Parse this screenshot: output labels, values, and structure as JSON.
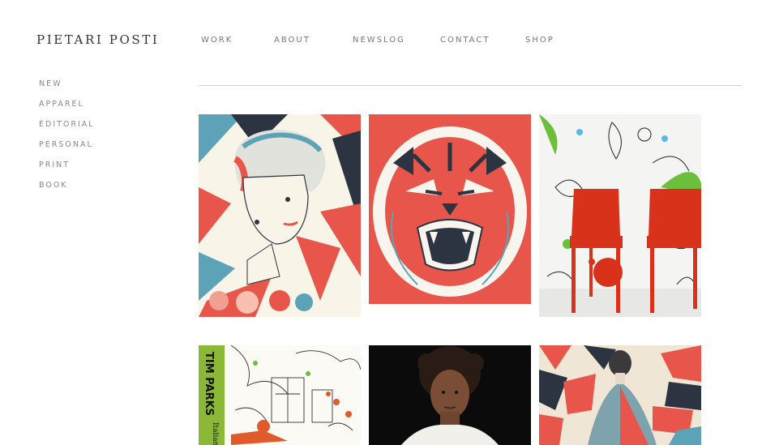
{
  "site": {
    "title": "PIETARI POSTI"
  },
  "topnav": {
    "items": [
      {
        "key": "work",
        "label": "WORK"
      },
      {
        "key": "about",
        "label": "ABOUT"
      },
      {
        "key": "newslog",
        "label": "NEWSLOG"
      },
      {
        "key": "contact",
        "label": "CONTACT"
      },
      {
        "key": "shop",
        "label": "SHOP"
      }
    ]
  },
  "sidenav": {
    "items": [
      {
        "key": "new",
        "label": "NEW"
      },
      {
        "key": "apparel",
        "label": "APPAREL"
      },
      {
        "key": "editorial",
        "label": "EDITORIAL"
      },
      {
        "key": "personal",
        "label": "PERSONAL"
      },
      {
        "key": "print",
        "label": "PRINT"
      },
      {
        "key": "book",
        "label": "BOOK"
      }
    ]
  },
  "gallery": {
    "book_cover": {
      "author": "TIM PARKS",
      "subtitle": "Italian"
    }
  },
  "colors": {
    "coral": "#e8554a",
    "teal": "#5ca3b8",
    "navy": "#2b3440",
    "cream": "#f8f4e8",
    "chair_red": "#d8321a",
    "leaf_green": "#6cbf3a",
    "book_green": "#8bb836"
  }
}
